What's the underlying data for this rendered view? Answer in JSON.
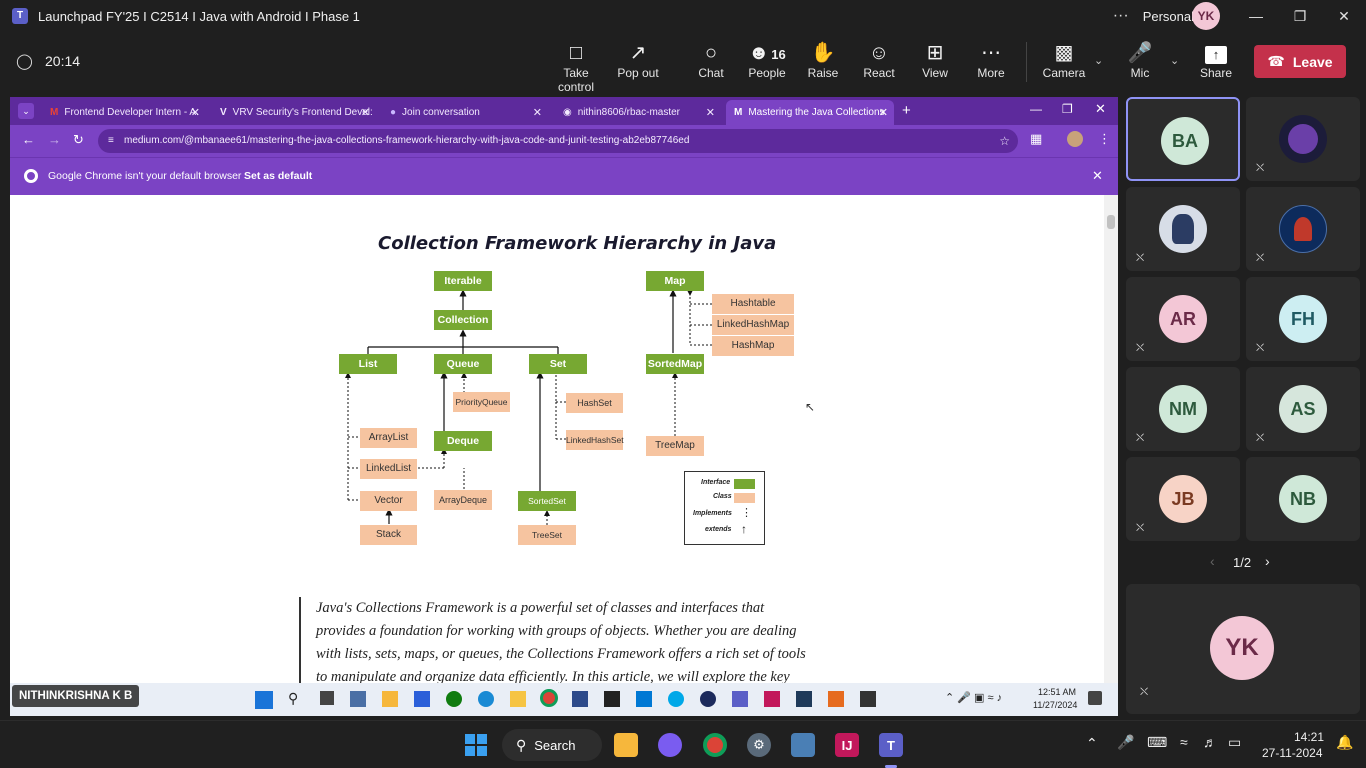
{
  "window": {
    "title": "Launchpad FY'25 I C2514 I Java with Android I Phase 1",
    "profile_label": "Personal",
    "profile_initials": "YK",
    "menu_icon": "more-icon"
  },
  "meeting": {
    "timer": "20:14",
    "people_count": "16"
  },
  "toolbar": {
    "take_control": "Take control",
    "pop_out": "Pop out",
    "chat": "Chat",
    "people": "People",
    "raise": "Raise",
    "react": "React",
    "view": "View",
    "more": "More",
    "camera": "Camera",
    "mic": "Mic",
    "share": "Share",
    "leave": "Leave"
  },
  "browser": {
    "tabs": [
      {
        "label": "Frontend Developer Intern - A:",
        "icon": "gmail-icon"
      },
      {
        "label": "VRV Security's Frontend Devel:",
        "icon": "vrv-icon"
      },
      {
        "label": "Join conversation",
        "icon": "teams-icon"
      },
      {
        "label": "nithin8606/rbac-master",
        "icon": "github-icon"
      },
      {
        "label": "Mastering the Java Collections",
        "icon": "medium-icon"
      }
    ],
    "url": "medium.com/@mbanaee61/mastering-the-java-collections-framework-hierarchy-with-java-code-and-junit-testing-ab2eb87746ed",
    "infobar_text": "Google Chrome isn't your default browser",
    "infobar_button": "Set as default"
  },
  "diagram": {
    "title": "Collection Framework Hierarchy in Java",
    "interfaces": {
      "iterable": "Iterable",
      "collection": "Collection",
      "list": "List",
      "queue": "Queue",
      "set": "Set",
      "deque": "Deque",
      "sortedset": "SortedSet",
      "map": "Map",
      "sortedmap": "SortedMap"
    },
    "classes": {
      "arraylist": "ArrayList",
      "linkedlist": "LinkedList",
      "vector": "Vector",
      "stack": "Stack",
      "priorityqueue": "PriorityQueue",
      "arraydeque": "ArrayDeque",
      "hashset": "HashSet",
      "linkedhashset": "LinkedHashSet",
      "treeset": "TreeSet",
      "hashtable": "Hashtable",
      "linkedhashmap": "LinkedHashMap",
      "hashmap": "HashMap",
      "treemap": "TreeMap"
    },
    "legend": {
      "interface": "Interface",
      "class": "Class",
      "implements": "Implements",
      "extends": "extends"
    },
    "colors": {
      "interface": "#77a832",
      "class": "#f6c4a0"
    }
  },
  "article": {
    "lines": [
      "Java's Collections Framework is a powerful set of classes and interfaces that",
      "provides a foundation for working with groups of objects. Whether you are dealing",
      "with lists, sets, maps, or queues, the Collections Framework offers a rich set of tools",
      "to manipulate and organize data efficiently. In this article, we will explore the key"
    ]
  },
  "inner_taskbar": {
    "time": "12:51 AM",
    "date": "11/27/2024"
  },
  "presenter_name": "NITHINKRISHNA K B",
  "participants": [
    {
      "initials": "BA",
      "bg": "#cfe8d8",
      "fg": "#2d5a3d"
    },
    {
      "initials": "",
      "bg": "#1c1c3a",
      "fg": "#fff"
    },
    {
      "initials": "",
      "bg": "#d7dde7",
      "fg": "#333"
    },
    {
      "initials": "",
      "bg": "#0d2b5c",
      "fg": "#fff"
    },
    {
      "initials": "AR",
      "bg": "#f3c7d6",
      "fg": "#6b2a48"
    },
    {
      "initials": "FH",
      "bg": "#cdeef2",
      "fg": "#1f5a63"
    },
    {
      "initials": "NM",
      "bg": "#cfe8d8",
      "fg": "#2d5a3d"
    },
    {
      "initials": "AS",
      "bg": "#d6e6dc",
      "fg": "#2d5a3d"
    },
    {
      "initials": "JB",
      "bg": "#f7d3c6",
      "fg": "#7a3a22"
    },
    {
      "initials": "NB",
      "bg": "#cfe8d8",
      "fg": "#2d5a3d"
    }
  ],
  "pagination": "1/2",
  "self_tile": {
    "initials": "YK"
  },
  "win_taskbar": {
    "search": "Search",
    "time": "14:21",
    "date": "27-11-2024"
  }
}
